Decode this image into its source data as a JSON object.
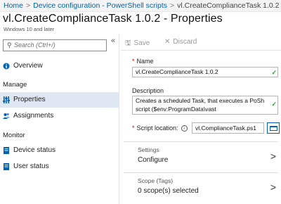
{
  "breadcrumb": {
    "items": [
      "Home",
      "Device configuration - PowerShell scripts"
    ],
    "current": "vl.CreateComplianceTask 1.0.2 - Properties"
  },
  "page": {
    "title": "vl.CreateComplianceTask 1.0.2 - Properties",
    "subtitle": "Windows 10 and later"
  },
  "sidebar": {
    "search_placeholder": "Search (Ctrl+/)",
    "overview": "Overview",
    "manage_header": "Manage",
    "properties": "Properties",
    "assignments": "Assignments",
    "monitor_header": "Monitor",
    "device_status": "Device status",
    "user_status": "User status"
  },
  "toolbar": {
    "save": "Save",
    "discard": "Discard"
  },
  "form": {
    "name_label": "Name",
    "name_value": "vl.CreateComplianceTask 1.0.2",
    "description_label": "Description",
    "description_line1": "Creates a scheduled Task, that executes a PoSh",
    "description_line2": "script ($env:ProgramData\\vast",
    "script_location_label": "Script location:",
    "script_location_value": "vl.ComplianceTask.ps1"
  },
  "settings": {
    "label": "Settings",
    "value": "Configure"
  },
  "scope": {
    "label": "Scope (Tags)",
    "value": "0 scope(s) selected"
  },
  "colors": {
    "accent": "#0063b1",
    "check": "#2e9f3c",
    "required": "#c00000",
    "active_nav": "#dfe7f2"
  }
}
